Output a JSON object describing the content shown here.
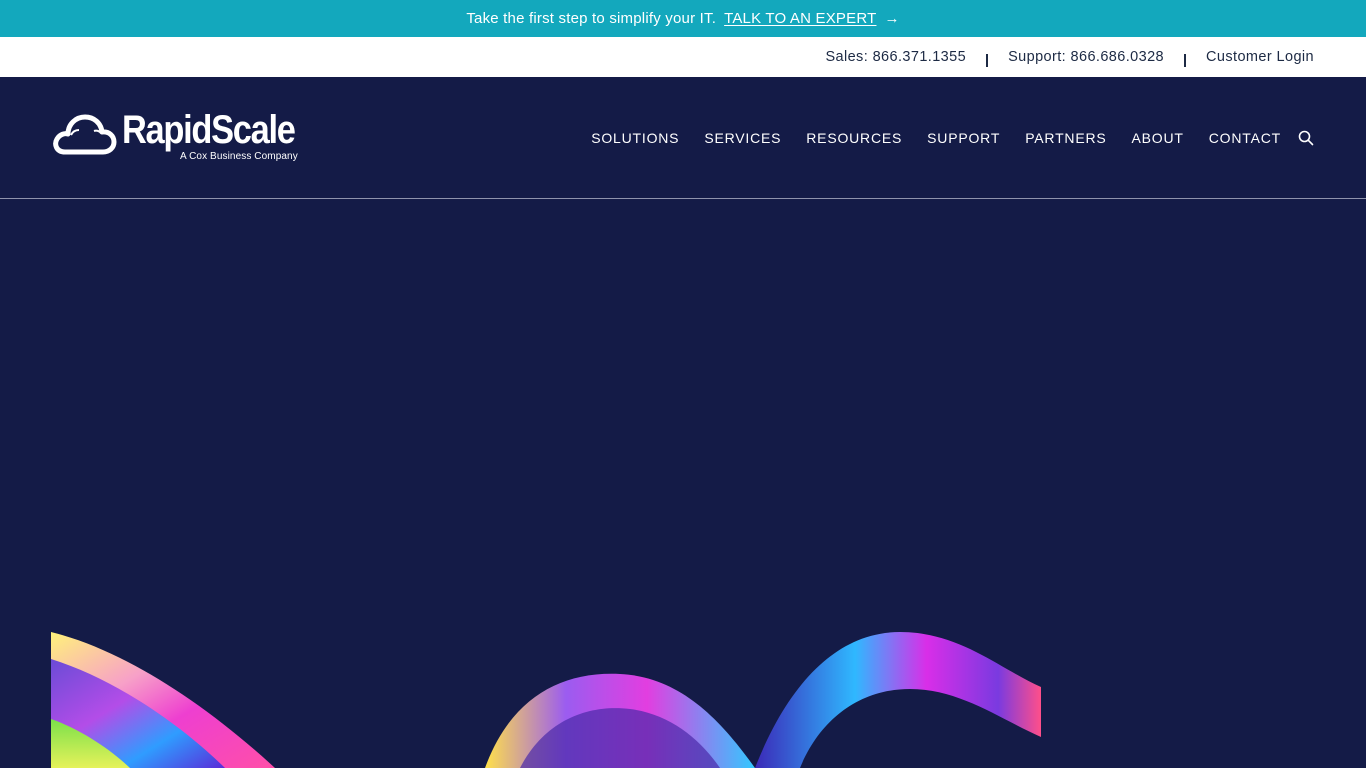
{
  "promo": {
    "text": "Take the first step to simplify your IT.",
    "link_label": "TALK TO AN EXPERT",
    "arrow": "→"
  },
  "utility": {
    "sales": "Sales: 866.371.1355",
    "support": "Support: 866.686.0328",
    "login": "Customer Login"
  },
  "brand": {
    "name": "RapidScale",
    "tagline": "A Cox Business Company",
    "logo_icon": "cloud-icon"
  },
  "nav": {
    "items": [
      {
        "label": "SOLUTIONS"
      },
      {
        "label": "SERVICES"
      },
      {
        "label": "RESOURCES"
      },
      {
        "label": "SUPPORT"
      },
      {
        "label": "PARTNERS"
      },
      {
        "label": "ABOUT"
      },
      {
        "label": "CONTACT"
      }
    ],
    "search_icon": "search-icon"
  },
  "colors": {
    "promo_bg": "#13a8bd",
    "header_bg": "#141b47",
    "utility_bg": "#ffffff",
    "utility_text": "#1d2a44"
  },
  "hero": {
    "image": "abstract-rainbow-ribbon-waves"
  }
}
